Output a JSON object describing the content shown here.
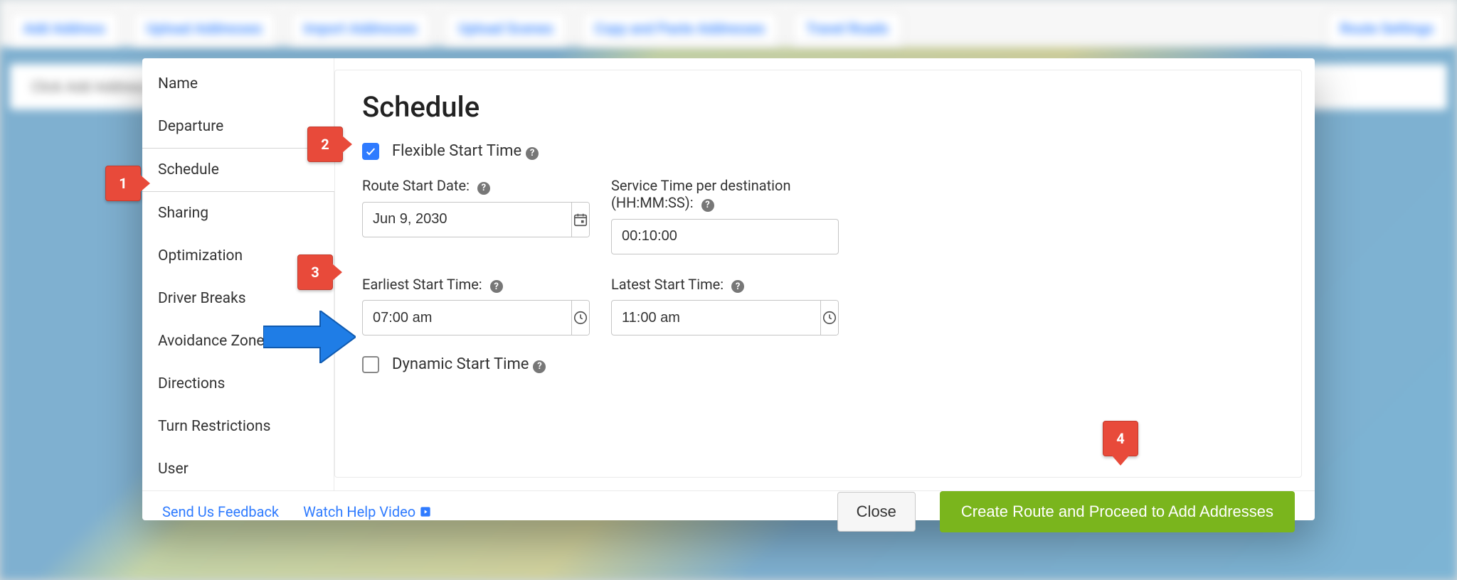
{
  "toolbar": {
    "items": [
      "Add Address",
      "Upload Addresses",
      "Import Addresses",
      "Upload Scenes",
      "Copy and Paste Addresses",
      "Travel Roads"
    ],
    "right": "Route Settings"
  },
  "hint": "Click Add Address to add destinations",
  "sidebar": {
    "items": [
      "Name",
      "Departure",
      "Schedule",
      "Sharing",
      "Optimization",
      "Driver Breaks",
      "Avoidance Zones",
      "Directions",
      "Turn Restrictions",
      "User"
    ],
    "active_index": 2
  },
  "pane": {
    "title": "Schedule",
    "flexible_label": "Flexible Start Time",
    "flexible_checked": true,
    "start_date_label": "Route Start Date:",
    "start_date_value": "Jun 9, 2030",
    "service_time_label": "Service Time per destination (HH:MM:SS):",
    "service_time_value": "00:10:00",
    "earliest_label": "Earliest Start Time:",
    "earliest_value": "07:00 am",
    "latest_label": "Latest Start Time:",
    "latest_value": "11:00 am",
    "dynamic_label": "Dynamic Start Time",
    "dynamic_checked": false
  },
  "footer": {
    "feedback": "Send Us Feedback",
    "help": "Watch Help Video",
    "close": "Close",
    "create": "Create Route and Proceed to Add Addresses"
  },
  "callouts": {
    "one": "1",
    "two": "2",
    "three": "3",
    "four": "4"
  }
}
